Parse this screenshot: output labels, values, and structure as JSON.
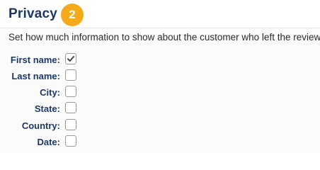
{
  "section": {
    "title": "Privacy",
    "step_number": "2",
    "description": "Set how much information to show about the customer who left the review."
  },
  "fields": [
    {
      "label": "First name:",
      "checked": true
    },
    {
      "label": "Last name:",
      "checked": false
    },
    {
      "label": "City:",
      "checked": false
    },
    {
      "label": "State:",
      "checked": false
    },
    {
      "label": "Country:",
      "checked": false
    },
    {
      "label": "Date:",
      "checked": false
    }
  ],
  "colors": {
    "title": "#1c3766",
    "badge": "#f6a91a",
    "checkmark": "#444444"
  },
  "icons": {
    "checked": "checkmark-icon"
  }
}
